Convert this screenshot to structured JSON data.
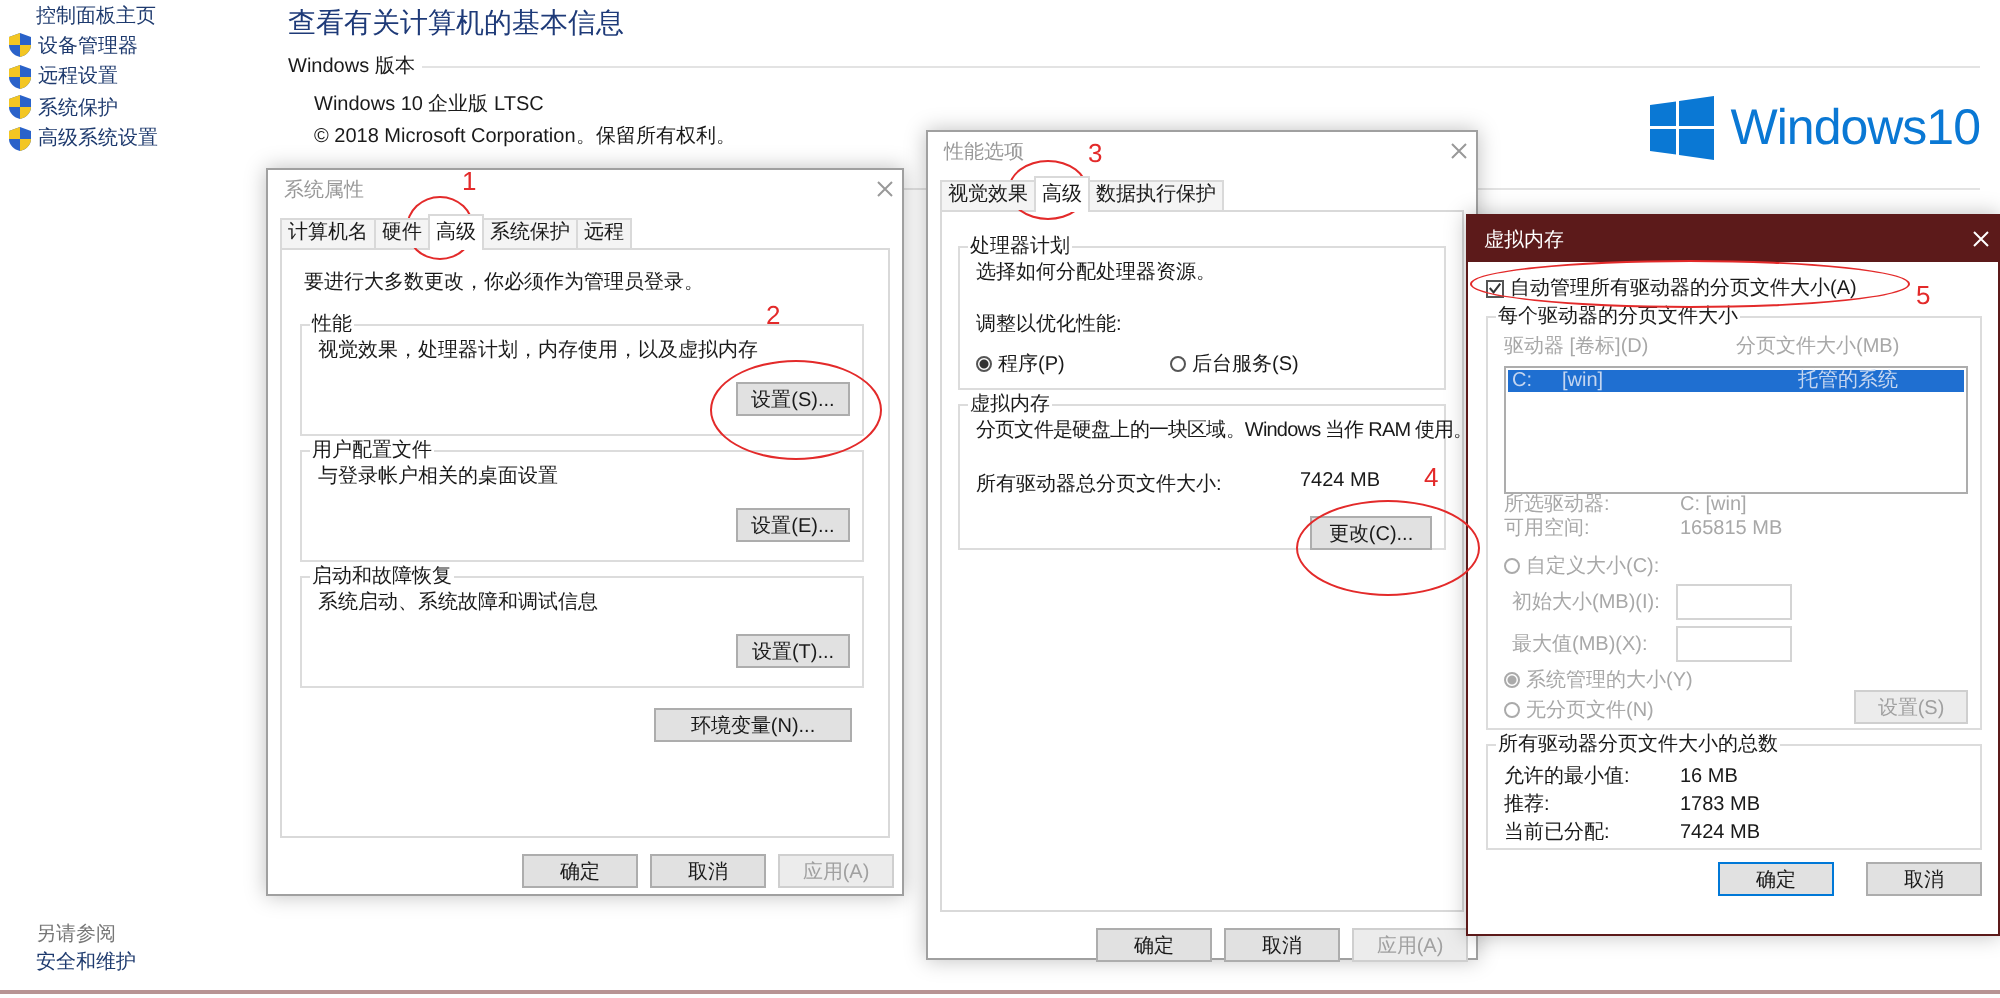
{
  "sidebar": {
    "home": "控制面板主页",
    "items": [
      {
        "label": "设备管理器",
        "kind": "shield"
      },
      {
        "label": "远程设置",
        "kind": "shield"
      },
      {
        "label": "系统保护",
        "kind": "shield"
      },
      {
        "label": "高级系统设置",
        "kind": "shield"
      }
    ],
    "see_also_title": "另请参阅",
    "see_also": [
      "安全和维护"
    ]
  },
  "main": {
    "title": "查看有关计算机的基本信息",
    "section": "Windows 版本",
    "edition": "Windows 10 企业版 LTSC",
    "copyright": "© 2018 Microsoft Corporation。保留所有权利。",
    "logo_text": "Windows10"
  },
  "system_properties": {
    "title": "系统属性",
    "tabs": [
      {
        "label": "计算机名",
        "selected": false
      },
      {
        "label": "硬件",
        "selected": false
      },
      {
        "label": "高级",
        "selected": true
      },
      {
        "label": "系统保护",
        "selected": false
      },
      {
        "label": "远程",
        "selected": false
      }
    ],
    "note": "要进行大多数更改，你必须作为管理员登录。",
    "groups": [
      {
        "title": "性能",
        "description": "视觉效果，处理器计划，内存使用，以及虚拟内存",
        "button": "设置(S)..."
      },
      {
        "title": "用户配置文件",
        "description": "与登录帐户相关的桌面设置",
        "button": "设置(E)..."
      },
      {
        "title": "启动和故障恢复",
        "description": "系统启动、系统故障和调试信息",
        "button": "设置(T)..."
      }
    ],
    "env_button": "环境变量(N)...",
    "buttons": [
      {
        "label": "确定",
        "disabled": false
      },
      {
        "label": "取消",
        "disabled": false
      },
      {
        "label": "应用(A)",
        "disabled": true
      }
    ]
  },
  "performance_options": {
    "title": "性能选项",
    "tabs": [
      {
        "label": "视觉效果",
        "selected": false
      },
      {
        "label": "高级",
        "selected": true
      },
      {
        "label": "数据执行保护",
        "selected": false
      }
    ],
    "processor": {
      "title": "处理器计划",
      "description": "选择如何分配处理器资源。",
      "prompt": "调整以优化性能:",
      "options": [
        {
          "label": "程序(P)",
          "selected": true
        },
        {
          "label": "后台服务(S)",
          "selected": false
        }
      ]
    },
    "virtual_memory": {
      "title": "虚拟内存",
      "description": "分页文件是硬盘上的一块区域。Windows 当作 RAM 使用。",
      "total_label": "所有驱动器总分页文件大小:",
      "total_value": "7424 MB",
      "button": "更改(C)..."
    },
    "buttons": [
      {
        "label": "确定",
        "disabled": false
      },
      {
        "label": "取消",
        "disabled": false
      },
      {
        "label": "应用(A)",
        "disabled": true
      }
    ]
  },
  "virtual_memory": {
    "title": "虚拟内存",
    "auto_manage": {
      "label": "自动管理所有驱动器的分页文件大小(A)",
      "checked": true
    },
    "per_drive": {
      "title": "每个驱动器的分页文件大小",
      "disabled": true,
      "columns": [
        "驱动器 [卷标](D)",
        "分页文件大小(MB)"
      ],
      "rows": [
        {
          "drive": "C:",
          "volume": "[win]",
          "size": "托管的系统",
          "selected": true
        }
      ],
      "info": [
        {
          "label": "所选驱动器:",
          "value": "C:  [win]"
        },
        {
          "label": "可用空间:",
          "value": "165815 MB"
        }
      ],
      "options": [
        {
          "kind": "radio",
          "label": "自定义大小(C):",
          "selected": false
        },
        {
          "kind": "field",
          "label": "初始大小(MB)(I):"
        },
        {
          "kind": "field",
          "label": "最大值(MB)(X):"
        },
        {
          "kind": "radio",
          "label": "系统管理的大小(Y)",
          "selected": true
        },
        {
          "kind": "radio",
          "label": "无分页文件(N)",
          "selected": false
        }
      ],
      "set_button": {
        "label": "设置(S)",
        "disabled": true
      }
    },
    "totals": {
      "title": "所有驱动器分页文件大小的总数",
      "rows": [
        {
          "label": "允许的最小值:",
          "value": "16 MB"
        },
        {
          "label": "推荐:",
          "value": "1783 MB"
        },
        {
          "label": "当前已分配:",
          "value": "7424 MB"
        }
      ]
    },
    "buttons": [
      {
        "label": "确定",
        "default": true
      },
      {
        "label": "取消",
        "default": false
      }
    ]
  },
  "annotations": [
    {
      "number": "1"
    },
    {
      "number": "2"
    },
    {
      "number": "3"
    },
    {
      "number": "4"
    },
    {
      "number": "5"
    }
  ]
}
